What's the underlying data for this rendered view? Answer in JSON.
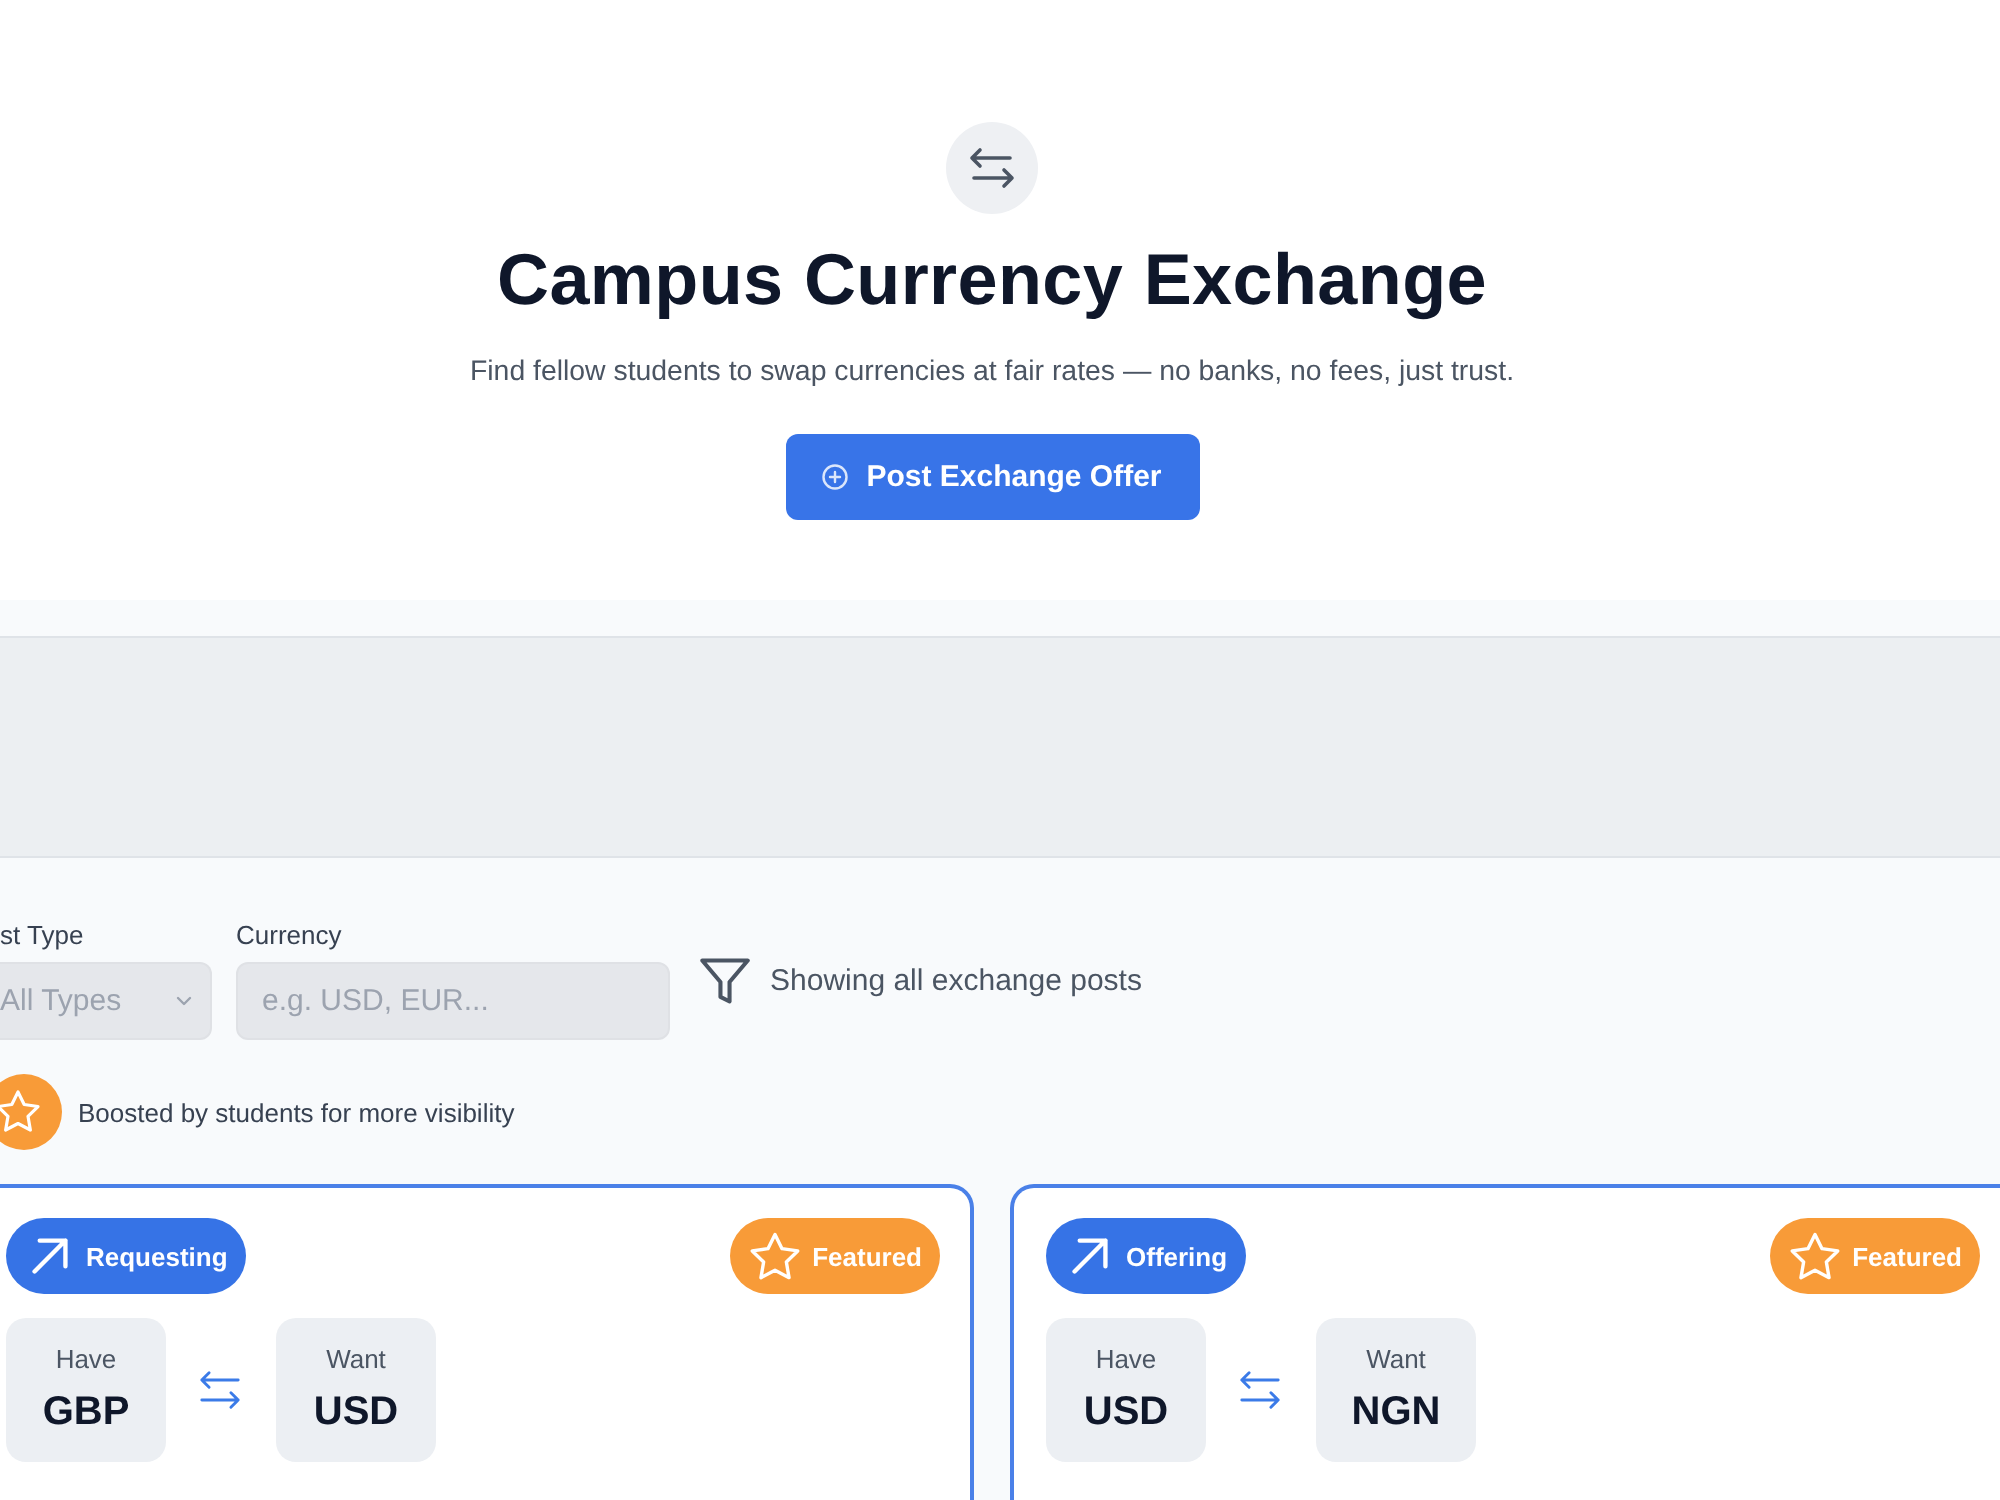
{
  "header": {
    "title": "Campus Currency Exchange",
    "subtitle": "Find fellow students to swap currencies at fair rates — no banks, no fees, just trust.",
    "post_button": "Post Exchange Offer"
  },
  "filters": {
    "post_type": {
      "label": "st Type",
      "value": "All Types"
    },
    "currency": {
      "label": "Currency",
      "placeholder": "e.g. USD, EUR..."
    },
    "status": "Showing all exchange posts"
  },
  "legend": {
    "text": "Boosted by students for more visibility"
  },
  "posts": [
    {
      "type_label": "Requesting",
      "featured": true,
      "featured_label": "Featured",
      "have_label": "Have",
      "have": "GBP",
      "want_label": "Want",
      "want": "USD"
    },
    {
      "type_label": "Offering",
      "featured": true,
      "featured_label": "Featured",
      "have_label": "Have",
      "have": "USD",
      "want_label": "Want",
      "want": "NGN"
    }
  ]
}
